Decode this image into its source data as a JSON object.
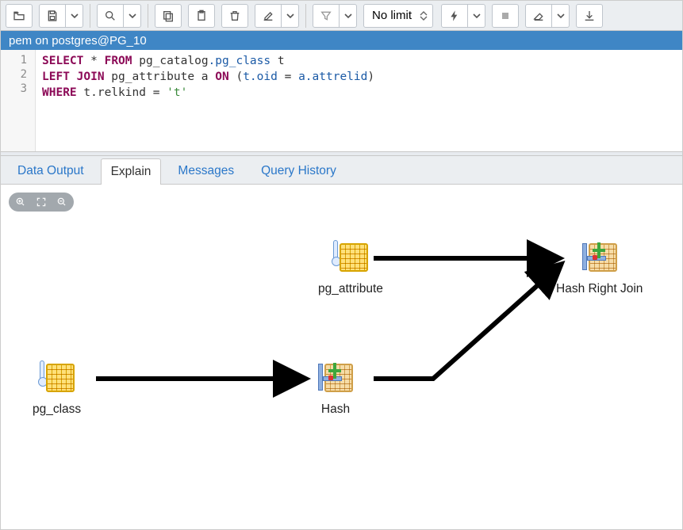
{
  "toolbar": {
    "limit_label": "No limit"
  },
  "header": {
    "title": "pem on postgres@PG_10"
  },
  "editor": {
    "gutter": [
      "1",
      "2",
      "3"
    ],
    "line1": {
      "select": "SELECT",
      "star": " * ",
      "from": "FROM",
      "schema": " pg_catalog",
      "dot": ".",
      "table": "pg_class",
      "alias": " t"
    },
    "line2": {
      "left_join": "LEFT JOIN",
      "table": " pg_attribute a ",
      "on": "ON",
      "open": " (",
      "col1": "t.oid",
      "eq": " = ",
      "col2": "a.attrelid",
      "close": ")"
    },
    "line3": {
      "where": "WHERE",
      "col": " t.relkind ",
      "eq": "= ",
      "str": "'t'"
    }
  },
  "tabs": {
    "data_output": "Data Output",
    "explain": "Explain",
    "messages": "Messages",
    "query_history": "Query History"
  },
  "explain": {
    "nodes": {
      "pg_attribute": "pg_attribute",
      "hash_right_join": "Hash Right Join",
      "pg_class": "pg_class",
      "hash": "Hash"
    }
  }
}
